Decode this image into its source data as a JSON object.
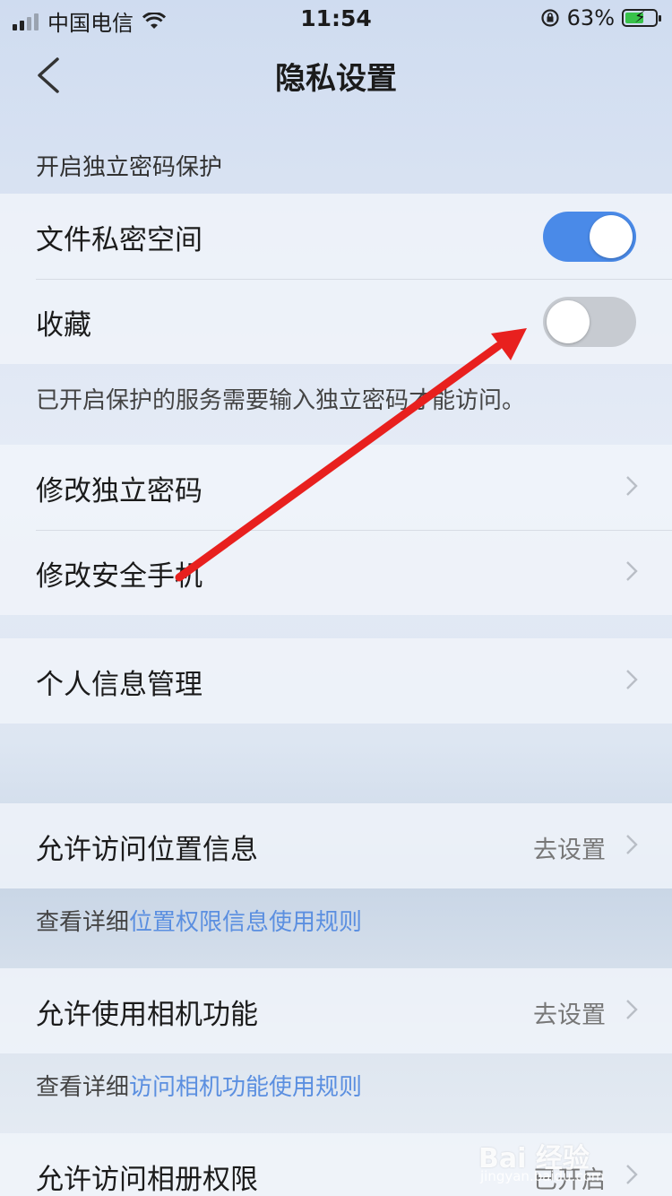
{
  "status_bar": {
    "carrier": "中国电信",
    "time": "11:54",
    "battery_percent": "63%",
    "battery_level": 0.63,
    "icons": [
      "signal-icon",
      "wifi-icon",
      "rotation-lock-icon",
      "battery-charging-icon"
    ]
  },
  "nav": {
    "title": "隐私设置",
    "back_icon": "chevron-left-icon"
  },
  "password_section": {
    "header": "开启独立密码保护",
    "items": [
      {
        "label": "文件私密空间",
        "toggle": true
      },
      {
        "label": "收藏",
        "toggle": false
      }
    ],
    "note": "已开启保护的服务需要输入独立密码才能访问。"
  },
  "password_manage": {
    "items": [
      {
        "label": "修改独立密码"
      },
      {
        "label": "修改安全手机"
      }
    ]
  },
  "personal": {
    "items": [
      {
        "label": "个人信息管理"
      }
    ]
  },
  "permissions": {
    "location": {
      "label": "允许访问位置信息",
      "value": "去设置",
      "note_prefix": "查看详细",
      "note_link": "位置权限信息使用规则"
    },
    "camera": {
      "label": "允许使用相机功能",
      "value": "去设置",
      "note_prefix": "查看详细",
      "note_link": "访问相机功能使用规则"
    },
    "album": {
      "label": "允许访问相册权限",
      "value": "已开启"
    }
  },
  "watermark": {
    "text": "Bai 经验",
    "sub": "jingyan.baidu.com"
  },
  "colors": {
    "toggle_on": "#4a8ae8",
    "toggle_off": "#c7cbd1",
    "link": "#5b8fe0",
    "annotation_arrow": "#e8201e"
  }
}
